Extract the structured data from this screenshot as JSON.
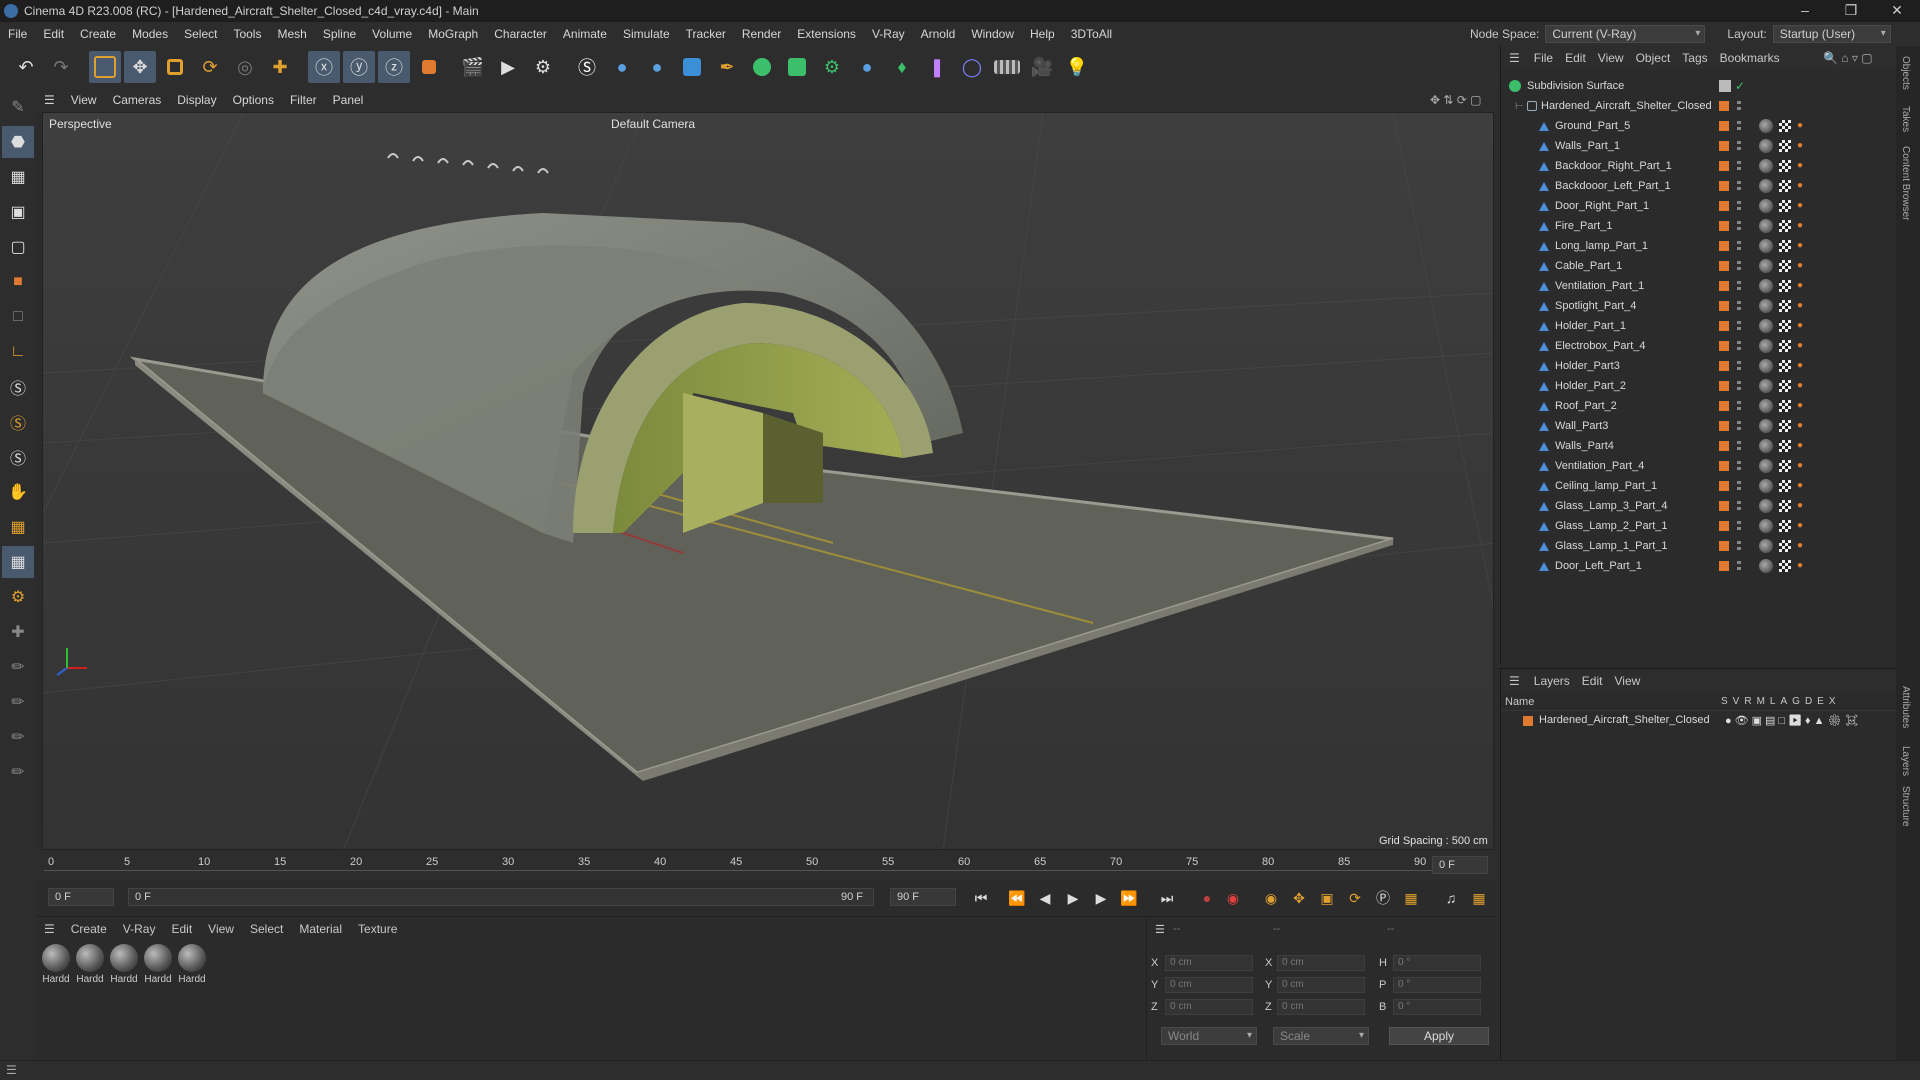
{
  "title": "Cinema 4D R23.008 (RC) - [Hardened_Aircraft_Shelter_Closed_c4d_vray.c4d] - Main",
  "window_controls": {
    "minimize": "–",
    "restore": "❐",
    "close": "✕"
  },
  "menu": [
    "File",
    "Edit",
    "Create",
    "Modes",
    "Select",
    "Tools",
    "Mesh",
    "Spline",
    "Volume",
    "MoGraph",
    "Character",
    "Animate",
    "Simulate",
    "Tracker",
    "Render",
    "Extensions",
    "V-Ray",
    "Arnold",
    "Window",
    "Help",
    "3DToAll"
  ],
  "node_space": {
    "label": "Node Space:",
    "value": "Current (V-Ray)"
  },
  "layout": {
    "label": "Layout:",
    "value": "Startup (User)"
  },
  "viewport_menu": [
    "View",
    "Cameras",
    "Display",
    "Options",
    "Filter",
    "Panel"
  ],
  "viewport": {
    "name": "Perspective",
    "camera": "Default Camera",
    "grid_spacing": "Grid Spacing : 500 cm"
  },
  "timeline": {
    "ticks": [
      "0",
      "5",
      "10",
      "15",
      "20",
      "25",
      "30",
      "35",
      "40",
      "45",
      "50",
      "55",
      "60",
      "65",
      "70",
      "75",
      "80",
      "85",
      "90"
    ],
    "current_frame_right": "0 F"
  },
  "playback": {
    "start": "0 F",
    "range_start": "0 F",
    "range_end": "90 F",
    "end": "90 F"
  },
  "material_menu": [
    "Create",
    "V-Ray",
    "Edit",
    "View",
    "Select",
    "Material",
    "Texture"
  ],
  "materials": [
    "Hardd",
    "Hardd",
    "Hardd",
    "Hardd",
    "Hardd"
  ],
  "attributes": {
    "dashes": [
      "--",
      "--",
      "--"
    ],
    "rows": [
      {
        "a": "X",
        "av": "0 cm",
        "b": "X",
        "bv": "0 cm",
        "c": "H",
        "cv": "0 °"
      },
      {
        "a": "Y",
        "av": "0 cm",
        "b": "Y",
        "bv": "0 cm",
        "c": "P",
        "cv": "0 °"
      },
      {
        "a": "Z",
        "av": "0 cm",
        "b": "Z",
        "bv": "0 cm",
        "c": "B",
        "cv": "0 °"
      }
    ],
    "coord_mode": "World",
    "size_mode": "Scale",
    "apply": "Apply"
  },
  "objects_menu": [
    "File",
    "Edit",
    "View",
    "Object",
    "Tags",
    "Bookmarks"
  ],
  "objects": {
    "root": "Subdivision Surface",
    "group": "Hardened_Aircraft_Shelter_Closed",
    "children": [
      "Ground_Part_5",
      "Walls_Part_1",
      "Backdoor_Right_Part_1",
      "Backdooor_Left_Part_1",
      "Door_Right_Part_1",
      "Fire_Part_1",
      "Long_lamp_Part_1",
      "Cable_Part_1",
      "Ventilation_Part_1",
      "Spotlight_Part_4",
      "Holder_Part_1",
      "Electrobox_Part_4",
      "Holder_Part3",
      "Holder_Part_2",
      "Roof_Part_2",
      "Wall_Part3",
      "Walls_Part4",
      "Ventilation_Part_4",
      "Ceiling_lamp_Part_1",
      "Glass_Lamp_3_Part_4",
      "Glass_Lamp_2_Part_1",
      "Glass_Lamp_1_Part_1",
      "Door_Left_Part_1"
    ]
  },
  "layers_menu": [
    "Layers",
    "Edit",
    "View"
  ],
  "layers": {
    "header_name": "Name",
    "columns": [
      "S",
      "V",
      "R",
      "M",
      "L",
      "A",
      "G",
      "D",
      "E",
      "X"
    ],
    "rows": [
      "Hardened_Aircraft_Shelter_Closed"
    ]
  },
  "side_tabs": [
    "Objects",
    "Takes",
    "Content Browser",
    "Attributes",
    "Layers",
    "Structure"
  ],
  "accent_colors": {
    "object_orange": "#e07a30",
    "selection_blue": "#4a5a6e",
    "layer_orange": "#e07a30"
  }
}
